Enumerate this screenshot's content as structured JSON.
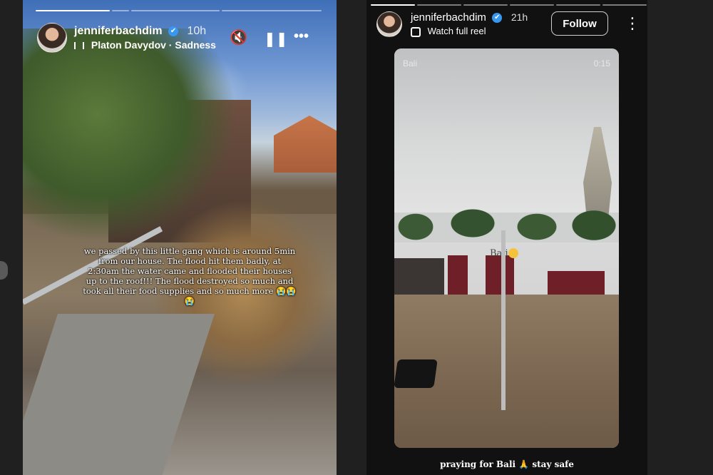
{
  "left_story": {
    "progress_segments": 4,
    "progress_current": 1,
    "username": "jenniferbachdim",
    "verified_glyph": "✔",
    "time": "10h",
    "music_icon": "music-bars-icon",
    "song": "Platon Davydov · Sadness",
    "caption": "we passed by this little gang which is around 5min from our house. The flood hit them badly, at 2:30am the water came and flooded their houses up to the roof!!! The flood destroyed so much and took all their food supplies and so much more 😭😭😭",
    "mute_glyph": "🔇",
    "pause_glyph": "❚❚",
    "more_glyph": "•••"
  },
  "right_story": {
    "progress_segments": 6,
    "progress_current": 1,
    "username": "jenniferbachdim",
    "verified_glyph": "✔",
    "time": "21h",
    "reel_label": "Watch full reel",
    "follow_label": "Follow",
    "kebab_glyph": "⋮",
    "reel": {
      "watermark_left": "Bali",
      "watermark_right": "0:15",
      "sign_text": "Bali"
    },
    "caption": "praying for Bali 🙏 stay safe"
  },
  "colors": {
    "page_bg": "#202020",
    "right_bg": "#111111",
    "verified": "#3897f0"
  }
}
